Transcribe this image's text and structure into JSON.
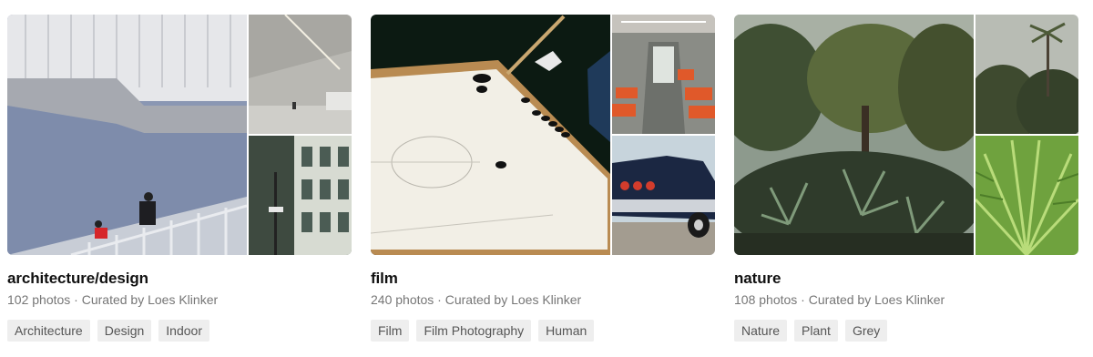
{
  "collections": [
    {
      "title": "architecture/design",
      "meta": "102 photos · Curated by Loes Klinker",
      "tags": [
        "Architecture",
        "Design",
        "Indoor"
      ]
    },
    {
      "title": "film",
      "meta": "240 photos · Curated by Loes Klinker",
      "tags": [
        "Film",
        "Film Photography",
        "Human"
      ]
    },
    {
      "title": "nature",
      "meta": "108 photos · Curated by Loes Klinker",
      "tags": [
        "Nature",
        "Plant",
        "Grey"
      ]
    }
  ],
  "colors": {
    "tag_background": "#eeeeee",
    "tag_text": "#555555",
    "meta_text": "#767676",
    "title_text": "#111111"
  }
}
